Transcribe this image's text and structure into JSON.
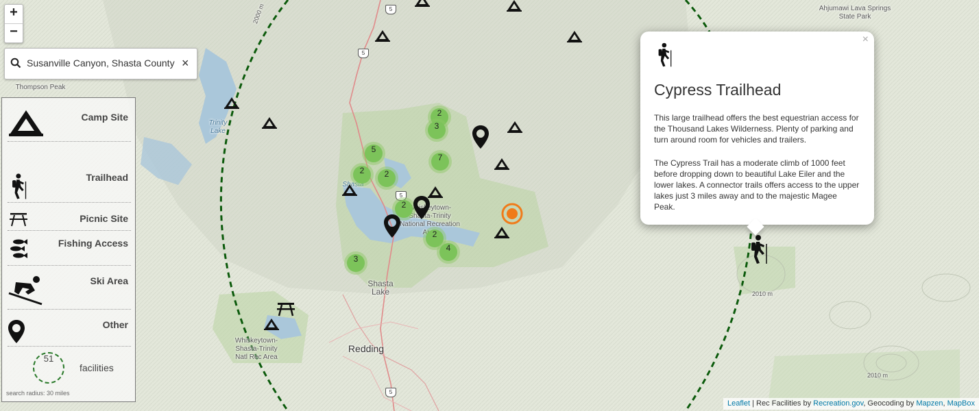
{
  "map": {
    "places": {
      "ahjumawi": "Ahjumawi Lava Springs State Park",
      "thompson": "Thompson Peak",
      "trinity": "Trinity Lake",
      "shasta_lake_water": "Shasta",
      "whiskeytown_shasta": "Whiskeytown-Shasta-Trinity National Recreation Area",
      "shasta_lake_city": "Shasta Lake",
      "redding": "Redding",
      "whiskeytown_nra": "Whiskeytown-Shasta-Trinity Natl Rec Area",
      "contour_2000": "2000 m",
      "contour_2010": "2010 m",
      "contour_2010b": "2010 m"
    },
    "highway_shields": [
      "5",
      "5",
      "5",
      "5"
    ],
    "clusters": [
      {
        "count": "2"
      },
      {
        "count": "3"
      },
      {
        "count": "5"
      },
      {
        "count": "7"
      },
      {
        "count": "2"
      },
      {
        "count": "2"
      },
      {
        "count": "2"
      },
      {
        "count": "2"
      },
      {
        "count": "4"
      },
      {
        "count": "3"
      }
    ],
    "selected_marker_color": "#f07b1a",
    "search_radius_color": "#0b5a0b"
  },
  "controls": {
    "zoom_in": "+",
    "zoom_out": "−",
    "search_value": "Susanville Canyon, Shasta County",
    "clear": "×"
  },
  "legend": {
    "items": [
      {
        "label": "Camp Site",
        "icon": "camp-site-icon"
      },
      {
        "label": "Trailhead",
        "icon": "hiker-icon"
      },
      {
        "label": "Picnic Site",
        "icon": "picnic-table-icon"
      },
      {
        "label": "Fishing Access",
        "icon": "fish-icon"
      },
      {
        "label": "Ski Area",
        "icon": "skier-icon"
      },
      {
        "label": "Other",
        "icon": "map-pin-icon"
      }
    ],
    "count": "51",
    "count_label": "facilities",
    "radius": "search radius: 30 miles"
  },
  "popup": {
    "close": "×",
    "icon": "hiker-icon",
    "title": "Cypress Trailhead",
    "paragraph1": "This large trailhead offers the best equestrian access for the Thousand Lakes Wilderness.  Plenty of parking and turn around room for vehicles and trailers.",
    "paragraph2": "The Cypress Trail has a moderate climb of 1000 feet before dropping down to beautiful Lake Eiler and the lower lakes.  A connector trails offers access to the upper lakes just 3 miles away and to the majestic Magee Peak."
  },
  "attribution": {
    "leaflet": "Leaflet",
    "sep1": " | Rec Facilities by ",
    "recgov": "Recreation.gov",
    "sep2": ", Geocoding by ",
    "mapzen": "Mapzen",
    "sep3": ", ",
    "mapbox": "MapBox"
  }
}
